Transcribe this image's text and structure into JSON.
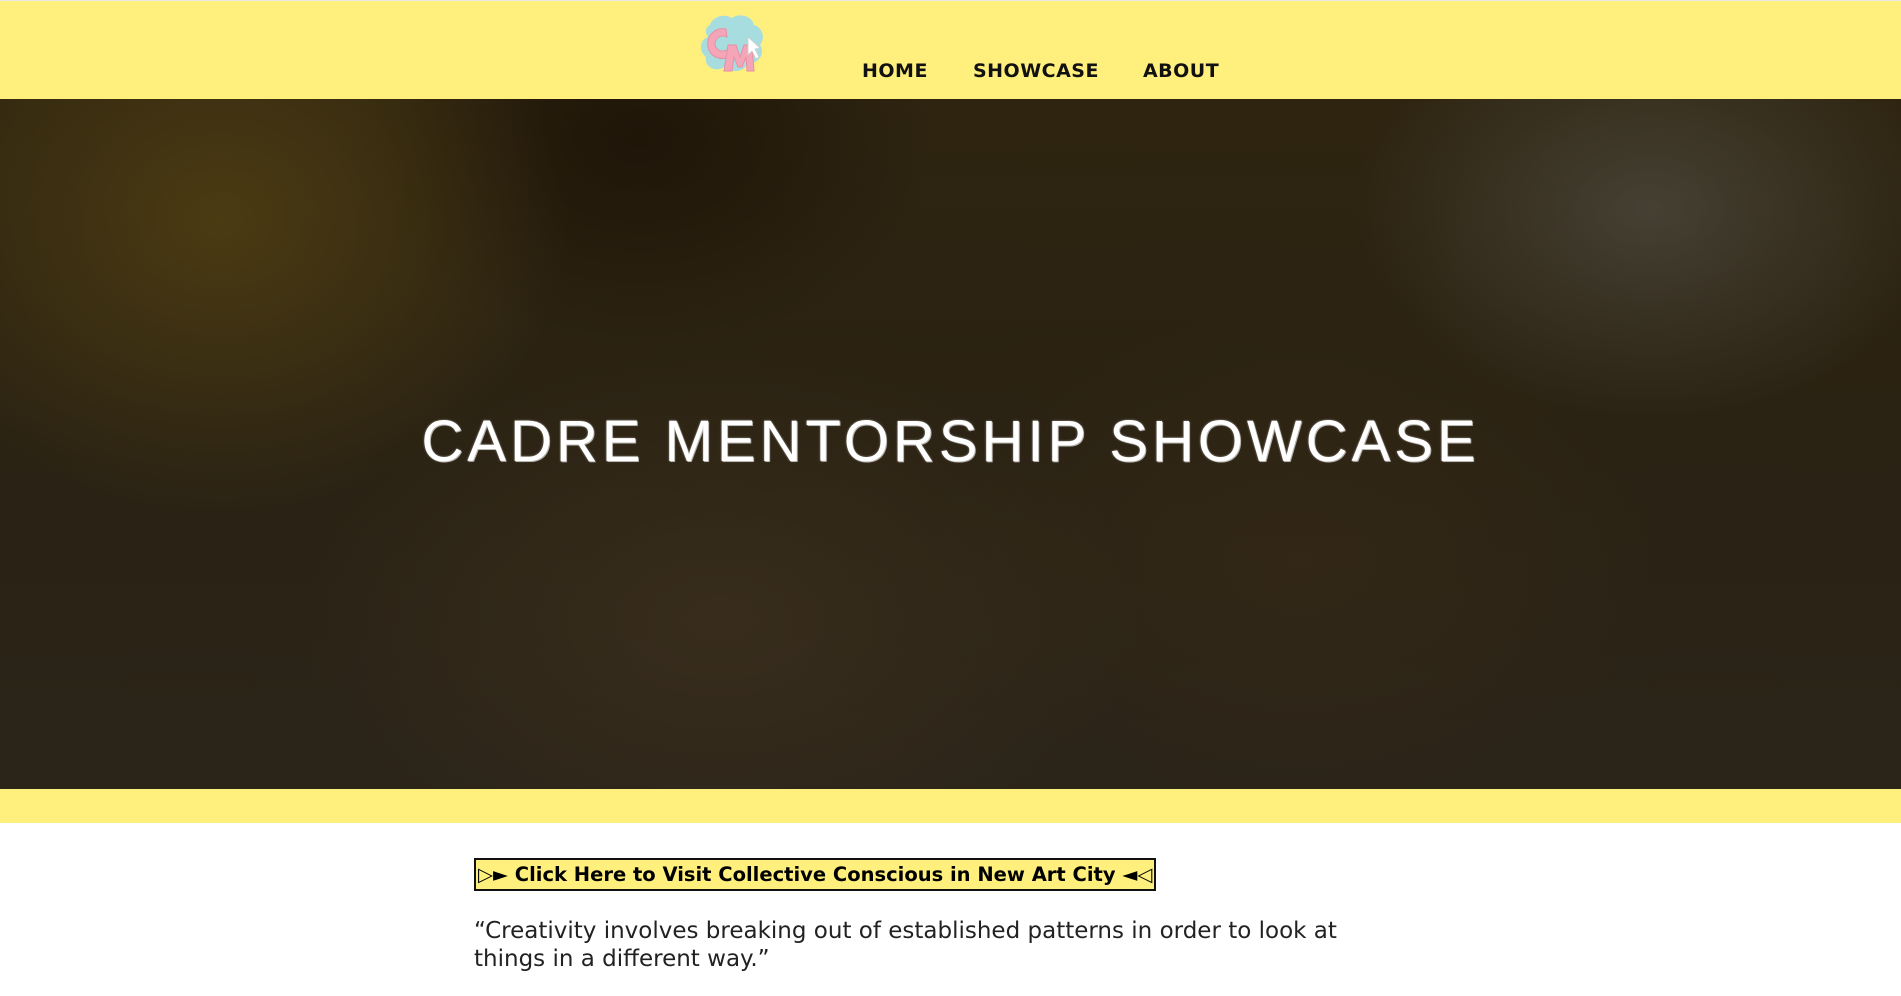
{
  "header": {
    "logo_text": "CM",
    "nav": [
      {
        "label": "HOME"
      },
      {
        "label": "SHOWCASE"
      },
      {
        "label": "ABOUT"
      }
    ]
  },
  "hero": {
    "title": "CADRE MENTORSHIP SHOWCASE"
  },
  "content": {
    "cta_label": "▷► Click Here to Visit Collective Conscious in New Art City ◄◁",
    "quote": "“Creativity involves breaking out of established patterns in order to look at things in a different way.”"
  },
  "colors": {
    "header_bg": "#FFF07E",
    "hero_bg": "#2b2314",
    "logo_pink": "#F4A6B8",
    "logo_blue": "#A8DDE0"
  },
  "icons": {
    "logo": "cm-logo-icon"
  }
}
